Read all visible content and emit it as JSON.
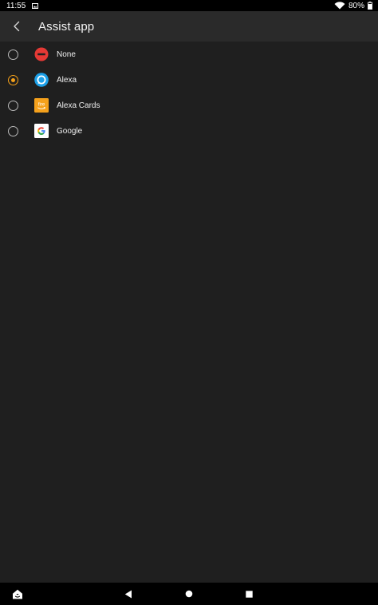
{
  "status_bar": {
    "time": "11:55",
    "battery": "80%",
    "wifi_icon": "wifi-icon",
    "battery_icon": "battery-icon",
    "notification_icon": "image-notification-icon"
  },
  "app_bar": {
    "title": "Assist app",
    "back_icon": "chevron-left-icon"
  },
  "options": [
    {
      "label": "None",
      "icon": "no-entry-icon",
      "selected": false
    },
    {
      "label": "Alexa",
      "icon": "alexa-icon",
      "selected": true
    },
    {
      "label": "Alexa Cards",
      "icon": "fire-icon",
      "selected": false
    },
    {
      "label": "Google",
      "icon": "google-icon",
      "selected": false
    }
  ],
  "nav_bar": {
    "home_icon": "fire-home-icon",
    "back_icon": "triangle-back-icon",
    "home_circle_icon": "circle-home-icon",
    "recents_icon": "square-recents-icon"
  },
  "colors": {
    "accent": "#f3a01a",
    "background": "#1f1f1f",
    "app_bar": "#2a2a2a",
    "alexa_blue": "#1ca0e8",
    "none_red": "#e53935"
  }
}
